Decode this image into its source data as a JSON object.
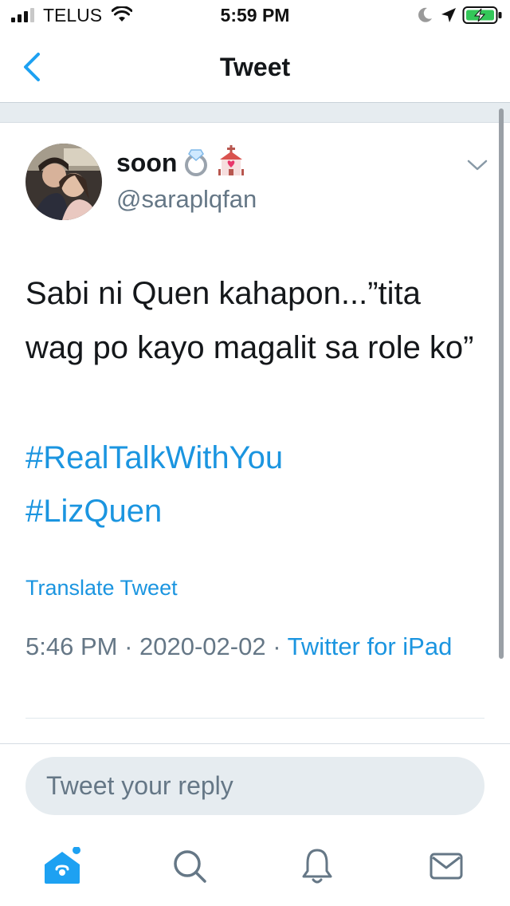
{
  "status_bar": {
    "carrier": "TELUS",
    "time": "5:59 PM",
    "icons": [
      "signal-icon",
      "wifi-icon",
      "moon-icon",
      "location-icon",
      "battery-charging-icon"
    ]
  },
  "nav": {
    "title": "Tweet",
    "back_icon": "chevron-left-icon"
  },
  "tweet": {
    "name": "soon",
    "name_emojis": [
      "ring-emoji",
      "wedding-chapel-emoji"
    ],
    "handle": "@saraplqfan",
    "text": "Sabi ni Quen kahapon...”tita wag po kayo magalit sa role ko”",
    "hashtags": [
      "#RealTalkWithYou",
      "#LizQuen"
    ],
    "translate_label": "Translate Tweet",
    "time": "5:46 PM",
    "date": "2020-02-02",
    "separator": " · ",
    "source": "Twitter for iPad"
  },
  "reply": {
    "placeholder": "Tweet your reply"
  },
  "tabs": [
    {
      "icon": "home-icon",
      "badge": true
    },
    {
      "icon": "search-icon",
      "badge": false
    },
    {
      "icon": "bell-icon",
      "badge": false
    },
    {
      "icon": "mail-icon",
      "badge": false
    }
  ],
  "colors": {
    "accent": "#1da1f2",
    "link": "#1b95e0",
    "secondary_text": "#657786"
  }
}
